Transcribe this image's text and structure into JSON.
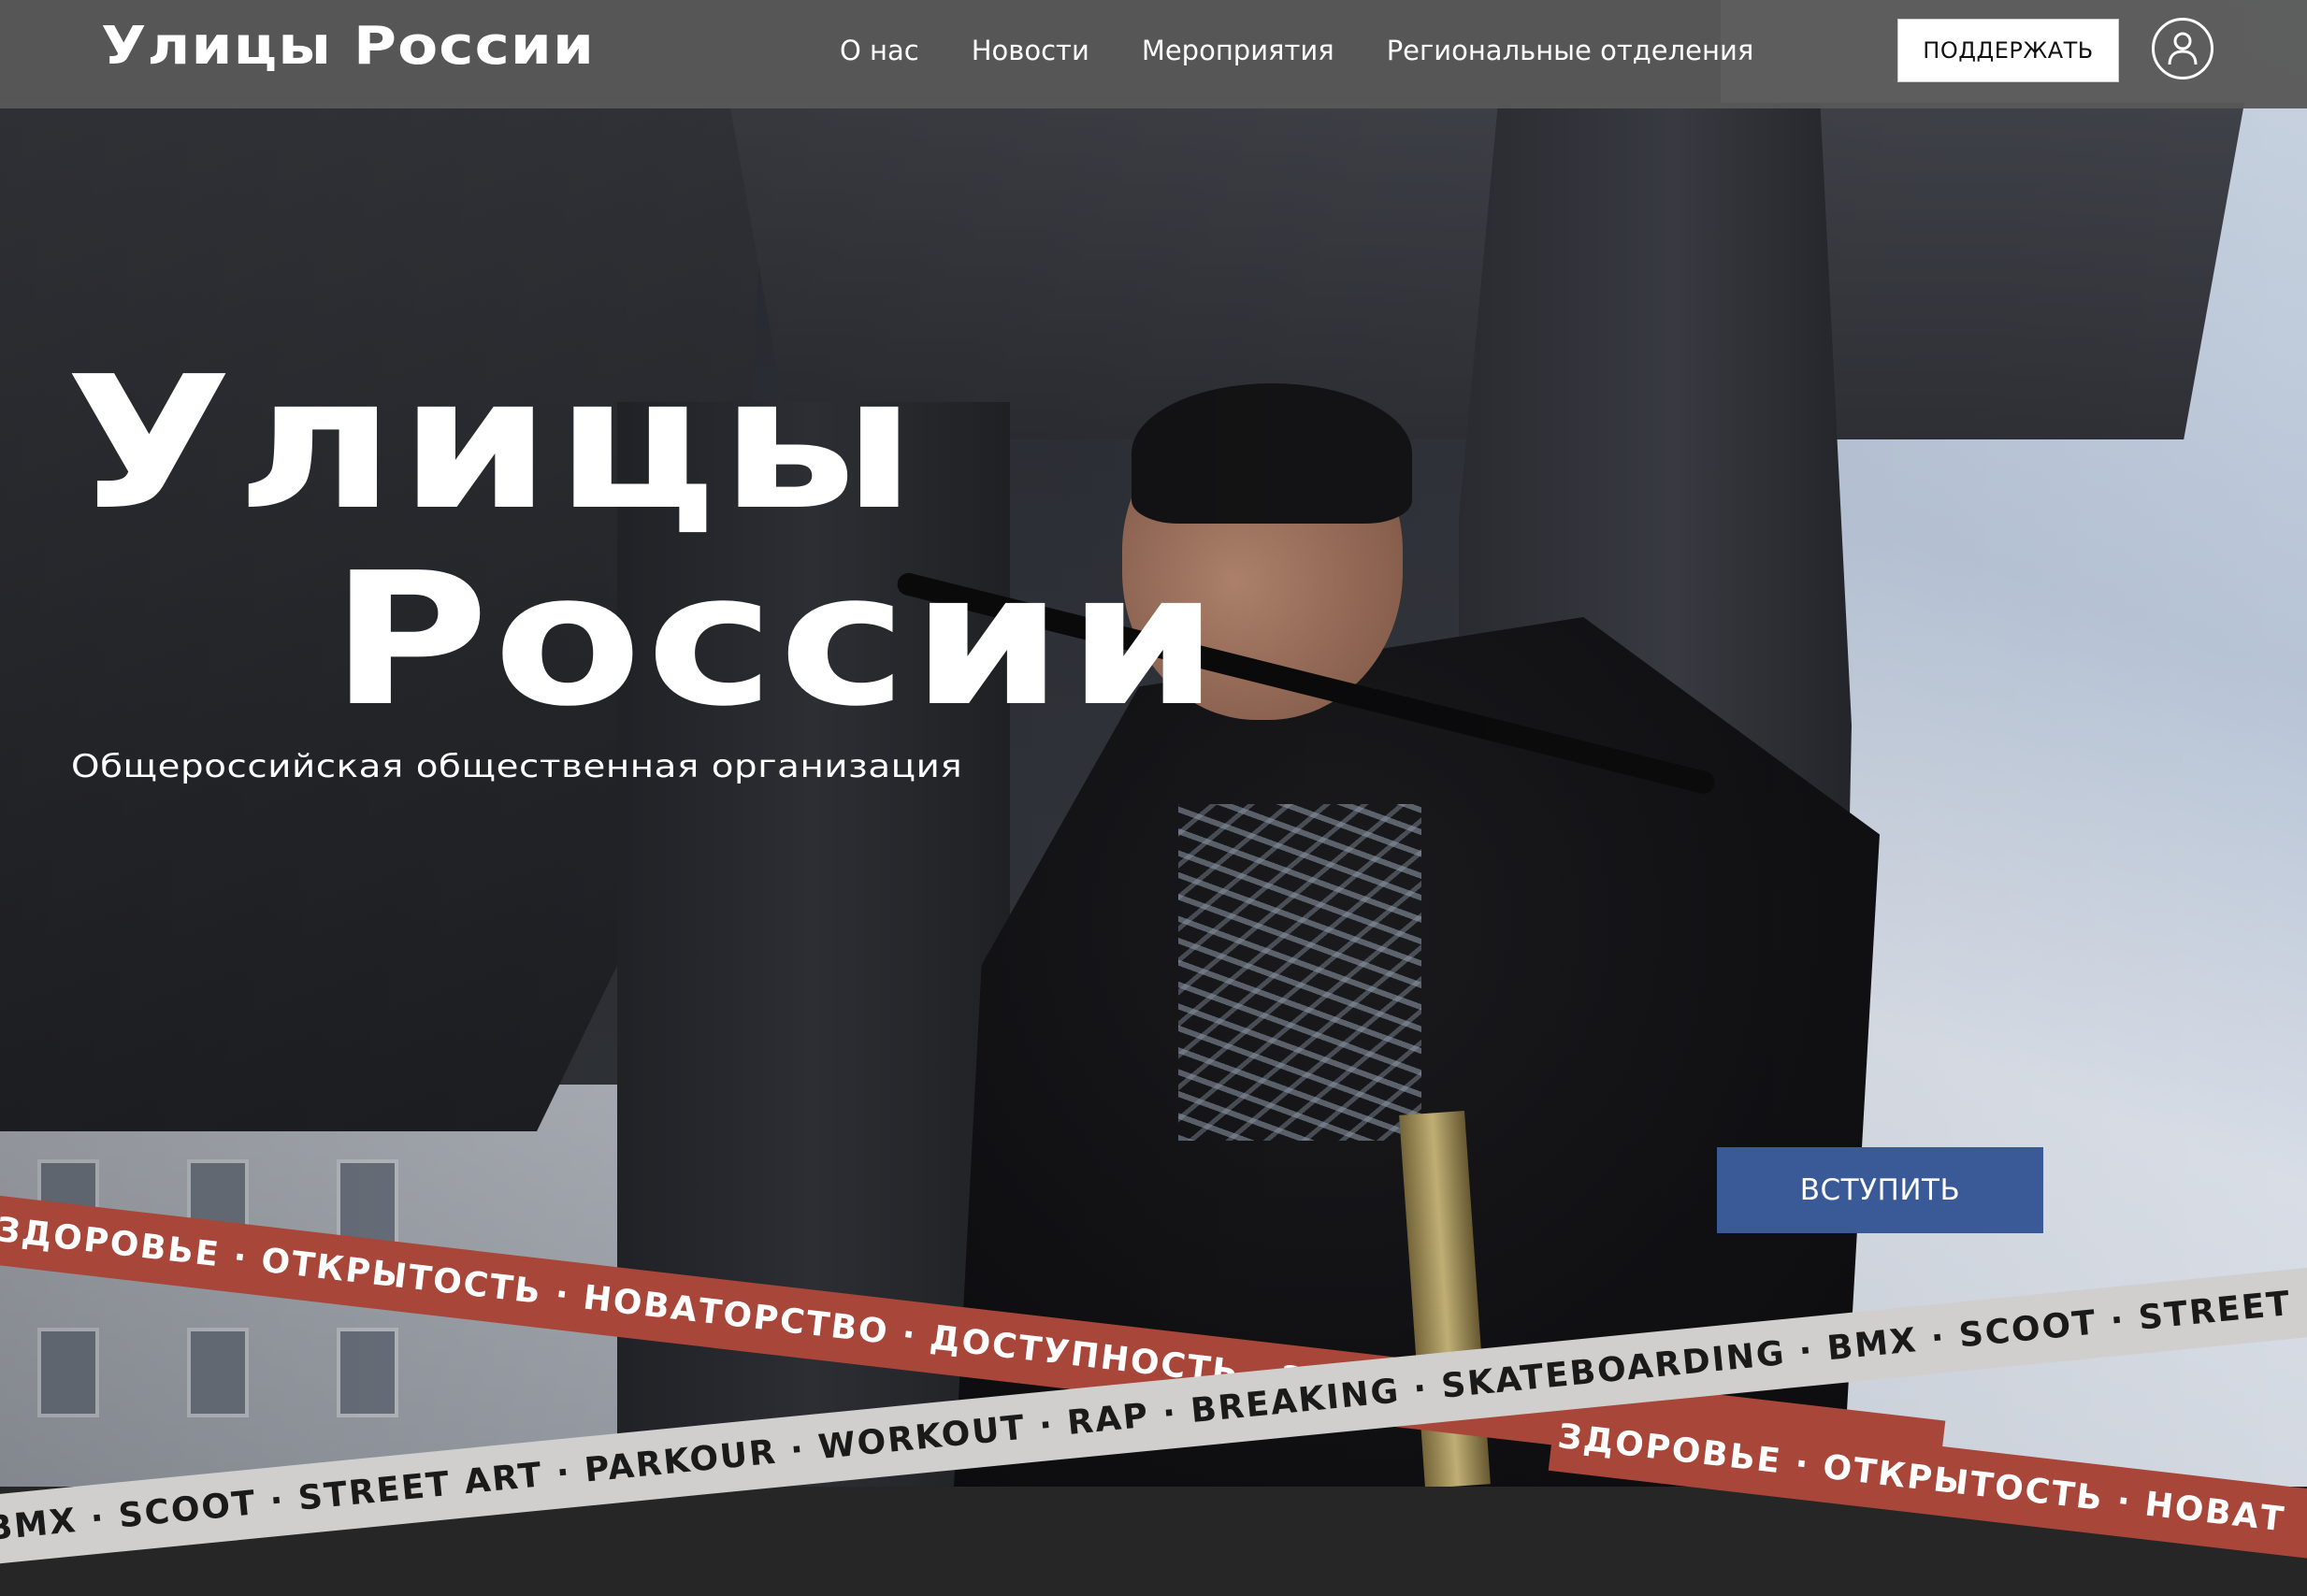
{
  "header": {
    "logo": "Улицы России",
    "nav": [
      "О нас",
      "Новости",
      "Мероприятия",
      "Региональные отделения"
    ],
    "support_label": "ПОДДЕРЖАТЬ",
    "user_icon": "user-icon"
  },
  "hero": {
    "title_line1": "Улицы",
    "title_line2": "России",
    "subtitle": "Общероссийская общественная организация",
    "join_label": "ВСТУПИТЬ"
  },
  "ribbons": {
    "values_text": "ЗДОРОВЬЕ · ОТКРЫТОСТЬ · НОВАТОРСТВО · ДОСТУПНОСТЬ · Э",
    "values_text_2": "ЗДОРОВЬЕ · ОТКРЫТОСТЬ · НОВАТ",
    "disciplines_text": "BMX · SCOOT · STREET ART · PARKOUR · WORKOUT · RAP · BREAKING · SKATEBOARDING · BMX · SCOOT · STREET"
  },
  "colors": {
    "header_bg": "#585858",
    "join_button": "#3a5a97",
    "ribbon_red": "#a8463a",
    "ribbon_grey": "#d0cfcd",
    "footer_bg": "#262626"
  }
}
